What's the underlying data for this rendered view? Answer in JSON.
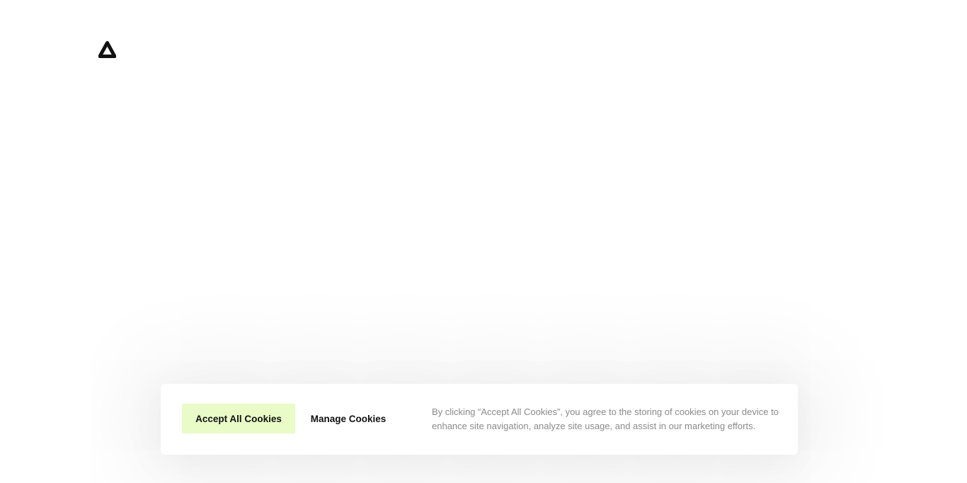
{
  "header": {
    "logo_icon": "brand-triangle-logo-icon"
  },
  "cookie_banner": {
    "accept_label": "Accept All Cookies",
    "manage_label": "Manage Cookies",
    "notice_text": "By clicking “Accept All Cookies”, you agree to the storing of cookies on your device to enhance site navigation, analyze site usage, and assist in our marketing efforts.",
    "accept_bg_color": "#e9fbc7"
  }
}
